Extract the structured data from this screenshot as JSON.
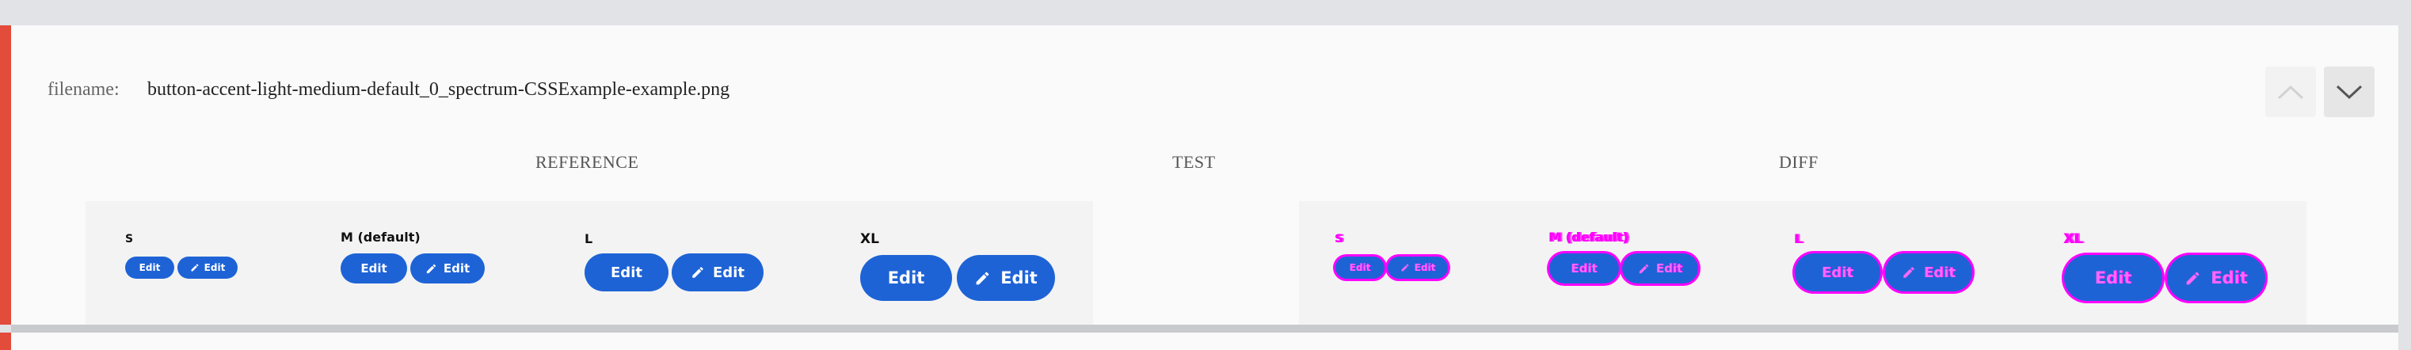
{
  "header": {
    "filename_label": "filename:",
    "filename_value": "button-accent-light-medium-default_0_spectrum-CSSExample-example.png"
  },
  "columns": {
    "reference": "REFERENCE",
    "test": "TEST",
    "diff": "DIFF"
  },
  "reference": {
    "sizes": [
      {
        "label": "S",
        "button": "Edit",
        "icon_button": "Edit"
      },
      {
        "label": "M (default)",
        "button": "Edit",
        "icon_button": "Edit"
      },
      {
        "label": "L",
        "button": "Edit",
        "icon_button": "Edit"
      },
      {
        "label": "XL",
        "button": "Edit",
        "icon_button": "Edit"
      }
    ]
  },
  "diff": {
    "sizes": [
      {
        "label": "S",
        "button": "Edit",
        "icon_button": "Edit"
      },
      {
        "label": "M (default)",
        "button": "Edit",
        "icon_button": "Edit"
      },
      {
        "label": "L",
        "button": "Edit",
        "icon_button": "Edit"
      },
      {
        "label": "XL",
        "button": "Edit",
        "icon_button": "Edit"
      }
    ]
  },
  "icons": {
    "nav_up": "chevron-up-icon",
    "nav_down": "chevron-down-icon",
    "pencil": "pencil-icon"
  },
  "colors": {
    "accent_bar": "#e34b3a",
    "button_accent": "#1e63d6",
    "diff_highlight": "#ff00ff"
  }
}
